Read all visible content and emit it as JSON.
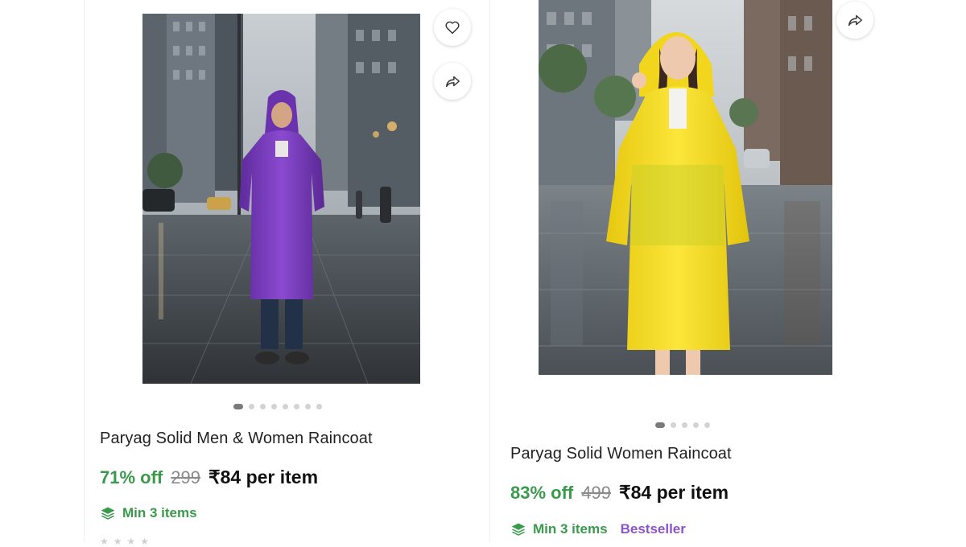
{
  "products": [
    {
      "title": "Paryag Solid Men & Women Raincoat",
      "discount": "71% off",
      "mrp": "299",
      "price": "₹84 per item",
      "min_items": "Min 3 items",
      "raincoat_color": "#7d3fc0",
      "carousel_dots": 8,
      "active_dot": 0,
      "icons": [
        "heart-icon",
        "share-icon",
        "layers-icon"
      ]
    },
    {
      "title": "Paryag Solid Women Raincoat",
      "discount": "83% off",
      "mrp": "499",
      "price": "₹84 per item",
      "min_items": "Min 3 items",
      "badge": "Bestseller",
      "raincoat_color": "#f3dd1f",
      "carousel_dots": 5,
      "active_dot": 0,
      "icons": [
        "share-icon",
        "layers-icon"
      ]
    }
  ],
  "colors": {
    "discount_green": "#3a9a4c",
    "bestseller_purple": "#8a55c8"
  }
}
